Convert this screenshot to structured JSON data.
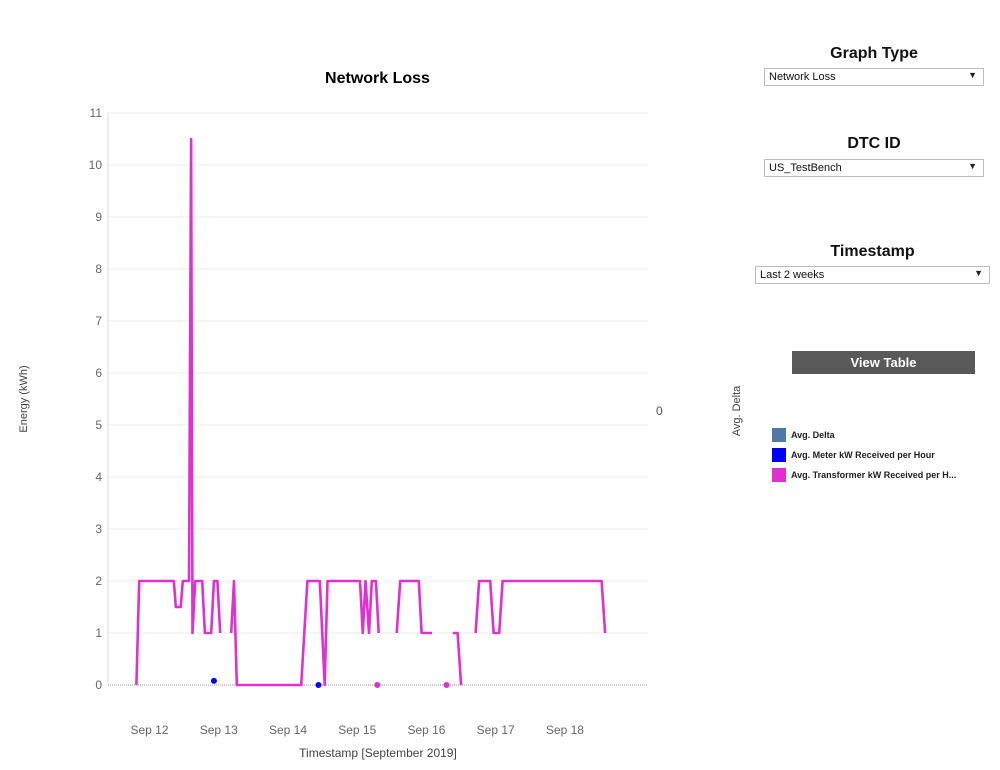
{
  "chart_data": {
    "type": "line",
    "title": "Network Loss",
    "xlabel": "Timestamp [September 2019]",
    "ylabel": "Energy (kWh)",
    "secondary_ylabel": "Avg. Delta",
    "secondary_axis_value": "0",
    "ylim": [
      0,
      11
    ],
    "yticks": [
      0,
      1,
      2,
      3,
      4,
      5,
      6,
      7,
      8,
      9,
      10,
      11
    ],
    "xlim": [
      11.4,
      19.2
    ],
    "xticks": [
      {
        "x": 12,
        "label": "Sep 12"
      },
      {
        "x": 13,
        "label": "Sep 13"
      },
      {
        "x": 14,
        "label": "Sep 14"
      },
      {
        "x": 15,
        "label": "Sep 15"
      },
      {
        "x": 16,
        "label": "Sep 16"
      },
      {
        "x": 17,
        "label": "Sep 17"
      },
      {
        "x": 18,
        "label": "Sep 18"
      }
    ],
    "series": [
      {
        "name": "Avg. Transformer kW Received per H...",
        "color": "#e030d0",
        "style": "line",
        "segments": [
          [
            [
              11.81,
              0
            ],
            [
              11.85,
              2
            ],
            [
              12.35,
              2
            ],
            [
              12.38,
              1.5
            ],
            [
              12.45,
              1.5
            ],
            [
              12.48,
              2
            ],
            [
              12.57,
              2
            ],
            [
              12.6,
              10.5
            ],
            [
              12.62,
              1
            ],
            [
              12.66,
              2
            ],
            [
              12.76,
              2
            ],
            [
              12.8,
              1
            ],
            [
              12.89,
              1
            ],
            [
              12.93,
              2
            ],
            [
              12.98,
              2
            ],
            [
              13.02,
              1
            ]
          ],
          [
            [
              13.18,
              1
            ],
            [
              13.22,
              2
            ],
            [
              13.26,
              0
            ],
            [
              14.19,
              0
            ],
            [
              14.28,
              2
            ],
            [
              14.46,
              2
            ],
            [
              14.53,
              0
            ],
            [
              14.57,
              2
            ],
            [
              15.04,
              2
            ],
            [
              15.08,
              1
            ],
            [
              15.12,
              2
            ],
            [
              15.17,
              1
            ],
            [
              15.21,
              2
            ],
            [
              15.27,
              2
            ],
            [
              15.31,
              1
            ]
          ],
          [
            [
              15.57,
              1
            ],
            [
              15.62,
              2
            ],
            [
              15.89,
              2
            ],
            [
              15.93,
              1
            ],
            [
              16.08,
              1
            ]
          ],
          [
            [
              16.38,
              1
            ],
            [
              16.45,
              1
            ],
            [
              16.5,
              0
            ]
          ],
          [
            [
              16.71,
              1
            ],
            [
              16.76,
              2
            ],
            [
              16.92,
              2
            ],
            [
              16.97,
              1
            ],
            [
              17.05,
              1
            ],
            [
              17.1,
              2
            ],
            [
              18.53,
              2
            ],
            [
              18.58,
              1
            ]
          ]
        ],
        "points": [
          [
            15.29,
            0
          ],
          [
            16.29,
            0
          ]
        ]
      },
      {
        "name": "Avg. Meter kW Received per Hour",
        "color": "#0000ff",
        "style": "points",
        "points": [
          [
            12.93,
            0.08
          ],
          [
            14.44,
            0
          ]
        ]
      },
      {
        "name": "Avg. Delta",
        "color": "#4e79a7",
        "style": "none",
        "values": []
      }
    ]
  },
  "controls": {
    "graph_type": {
      "title": "Graph Type",
      "value": "Network Loss"
    },
    "dtc_id": {
      "title": "DTC ID",
      "value": "US_TestBench"
    },
    "timestamp": {
      "title": "Timestamp",
      "value": "Last 2 weeks"
    },
    "view_table_label": "View Table"
  },
  "legend": [
    {
      "label": "Avg. Delta",
      "color": "#4e79a7"
    },
    {
      "label": "Avg. Meter kW Received per Hour",
      "color": "#0000ff"
    },
    {
      "label": "Avg. Transformer kW Received per H...",
      "color": "#e030d0"
    }
  ],
  "icons": {
    "dropdown": "caret-down-icon"
  }
}
